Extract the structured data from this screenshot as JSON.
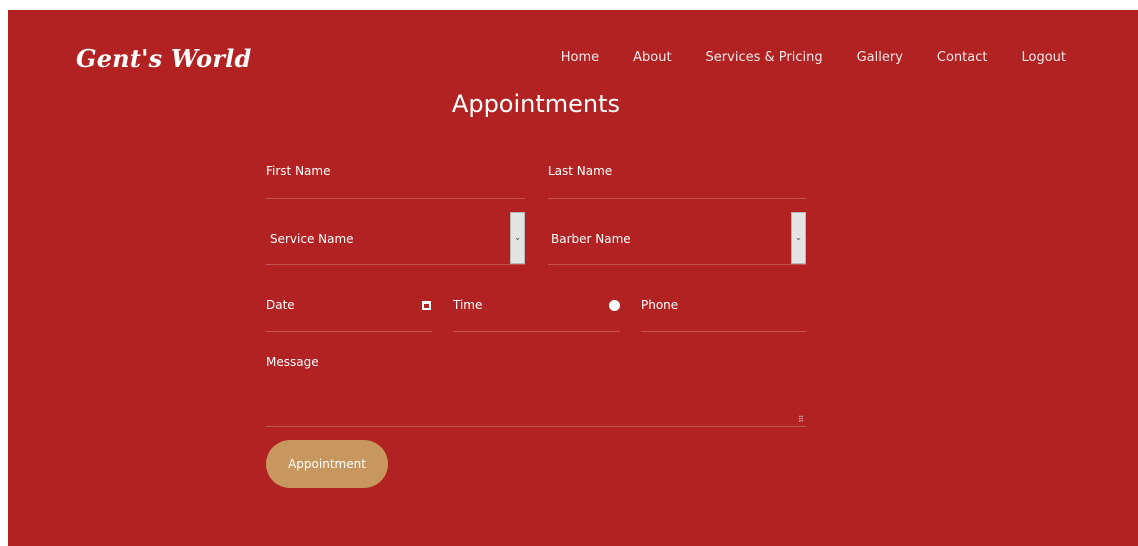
{
  "brand": {
    "name": "Gent's World"
  },
  "nav": {
    "items": [
      {
        "label": "Home"
      },
      {
        "label": "About"
      },
      {
        "label": "Services & Pricing"
      },
      {
        "label": "Gallery"
      },
      {
        "label": "Contact"
      },
      {
        "label": "Logout"
      }
    ]
  },
  "page": {
    "title": "Appointments"
  },
  "form": {
    "first_name": {
      "placeholder": "First Name"
    },
    "last_name": {
      "placeholder": "Last Name"
    },
    "service": {
      "selected": "Service Name"
    },
    "barber": {
      "selected": "Barber Name"
    },
    "date": {
      "placeholder": "Date"
    },
    "time": {
      "placeholder": "Time"
    },
    "phone": {
      "placeholder": "Phone"
    },
    "message": {
      "placeholder": "Message"
    },
    "submit_label": "Appointment"
  },
  "icons": {
    "select_arrow": "chevron-down-icon",
    "date": "calendar-icon",
    "time": "clock-icon",
    "resize": "resize-handle-icon"
  },
  "colors": {
    "background": "#b22222",
    "button": "#c8965f",
    "text": "#ffffff"
  }
}
